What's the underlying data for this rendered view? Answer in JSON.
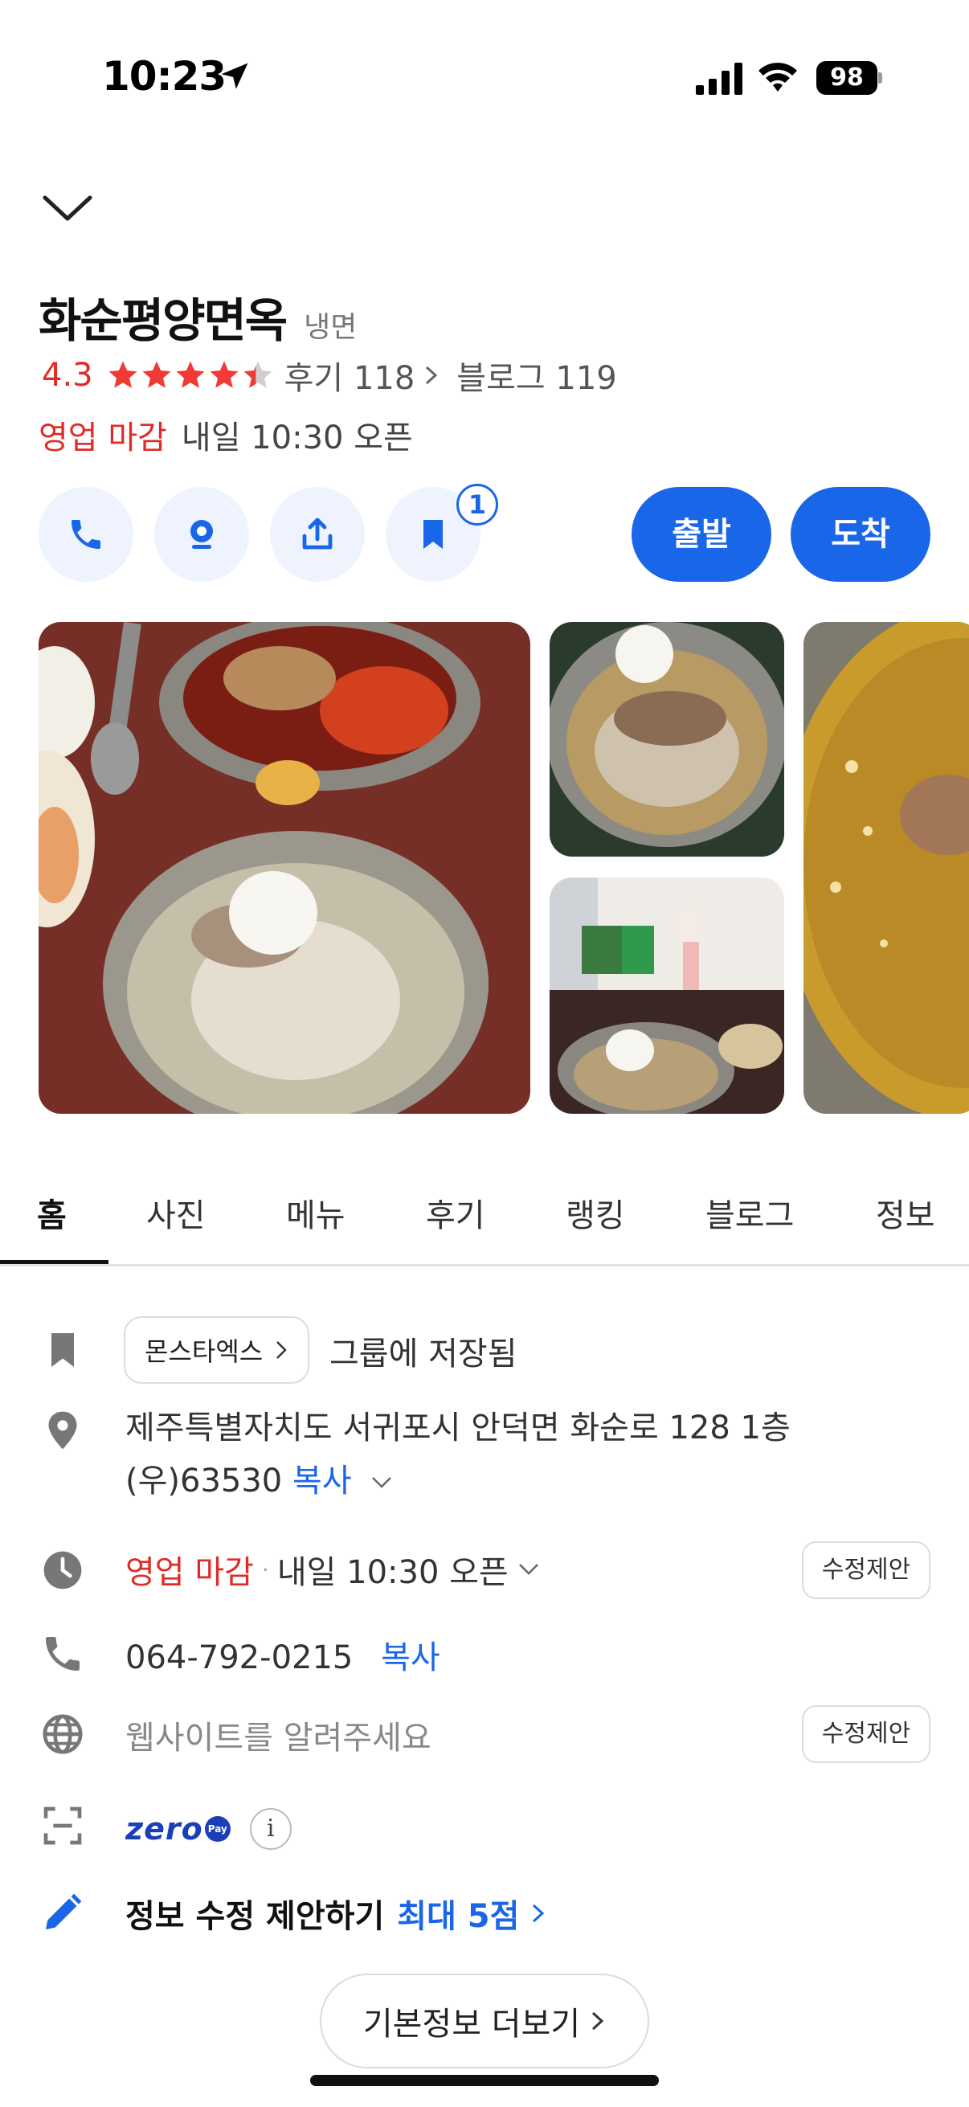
{
  "status_bar": {
    "time": "10:23",
    "battery": "98"
  },
  "place": {
    "name": "화순평양면옥",
    "category": "냉면",
    "rating": "4.3",
    "reviews_label": "후기 118",
    "blog_label": "블로그 119",
    "status_closed": "영업 마감",
    "next_open": "내일 10:30 오픈"
  },
  "actions": {
    "bookmark_badge": "1",
    "depart_label": "출발",
    "arrive_label": "도착"
  },
  "tabs": [
    "홈",
    "사진",
    "메뉴",
    "후기",
    "랭킹",
    "블로그",
    "정보"
  ],
  "info": {
    "group_chip": "몬스타엑스",
    "saved_text": "그룹에 저장됨",
    "address": "제주특별자치도 서귀포시 안덕면 화순로 128 1층 (우)63530",
    "address_copy": "복사",
    "hours_closed": "영업 마감",
    "hours_separator": "·",
    "hours_next": "내일 10:30 오픈",
    "suggest_label": "수정제안",
    "phone": "064-792-0215",
    "phone_copy": "복사",
    "website_placeholder": "웹사이트를 알려주세요",
    "zeropay_logo": "zero",
    "zeropay_mark": "Pay",
    "info_glyph": "i",
    "edit_suggest": "정보 수정 제안하기",
    "edit_reward": "최대 5점",
    "more_button": "기본정보 더보기"
  },
  "colors": {
    "accent": "#1a66e8",
    "closed": "#e02b27",
    "star": "#f03a36"
  }
}
